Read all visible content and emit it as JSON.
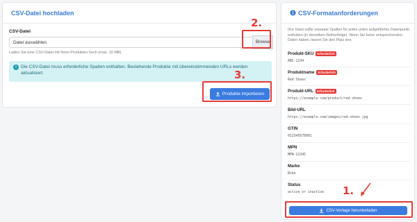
{
  "upload": {
    "title": "CSV-Datei hochladen",
    "file_label": "CSV-Datei",
    "file_value": "Datei auswählen",
    "browse_label": "Browse",
    "hint": "Laden Sie eine CSV-Datei mit Ihren Produkten hoch (max. 10 MB)",
    "info_icon": "i",
    "alert_text": "Die CSV-Datei muss erforderliche Spalten enthalten. Bestehende Produkte mit übereinstimmenden URLs werden aktualisiert.",
    "import_label": "Produkte importieren",
    "upload_icon": "upload-icon"
  },
  "requirements": {
    "title": "CSV-Formatanforderungen",
    "intro": "Ihre Datei sollte separate Spalten für jeden unten aufgeführten Datenpunkt enthalten (in derselben Reihenfolge). Wenn Sie keine entsprechenden Daten haben, lassen Sie den Platz leer.",
    "required_badge": "Erforderlich",
    "fields": [
      {
        "name": "Produkt-SKU",
        "example": "ABC-1234",
        "required": true
      },
      {
        "name": "Produktname",
        "example": "Red Shoes",
        "required": true
      },
      {
        "name": "Produkt-URL",
        "example": "https://example.com/product/red-shoes",
        "required": true
      },
      {
        "name": "Bild-URL",
        "example": "https://example.com/images/red-shoes.jpg",
        "required": false
      },
      {
        "name": "GTIN",
        "example": "012345678901",
        "required": false
      },
      {
        "name": "MPN",
        "example": "MPN-12345",
        "required": false
      },
      {
        "name": "Marke",
        "example": "Nike",
        "required": false
      },
      {
        "name": "Status",
        "example": "active or inactive",
        "required": false
      }
    ],
    "download_label": "CSV-Vorlage herunterladen"
  },
  "annotations": {
    "step1": "1.",
    "step2": "2.",
    "step3": "3.",
    "color": "#e53935"
  },
  "colors": {
    "accent": "#3b7be0",
    "header_text": "#3a7bd5",
    "alert_bg": "#d4f1f4",
    "required": "#e53935"
  }
}
